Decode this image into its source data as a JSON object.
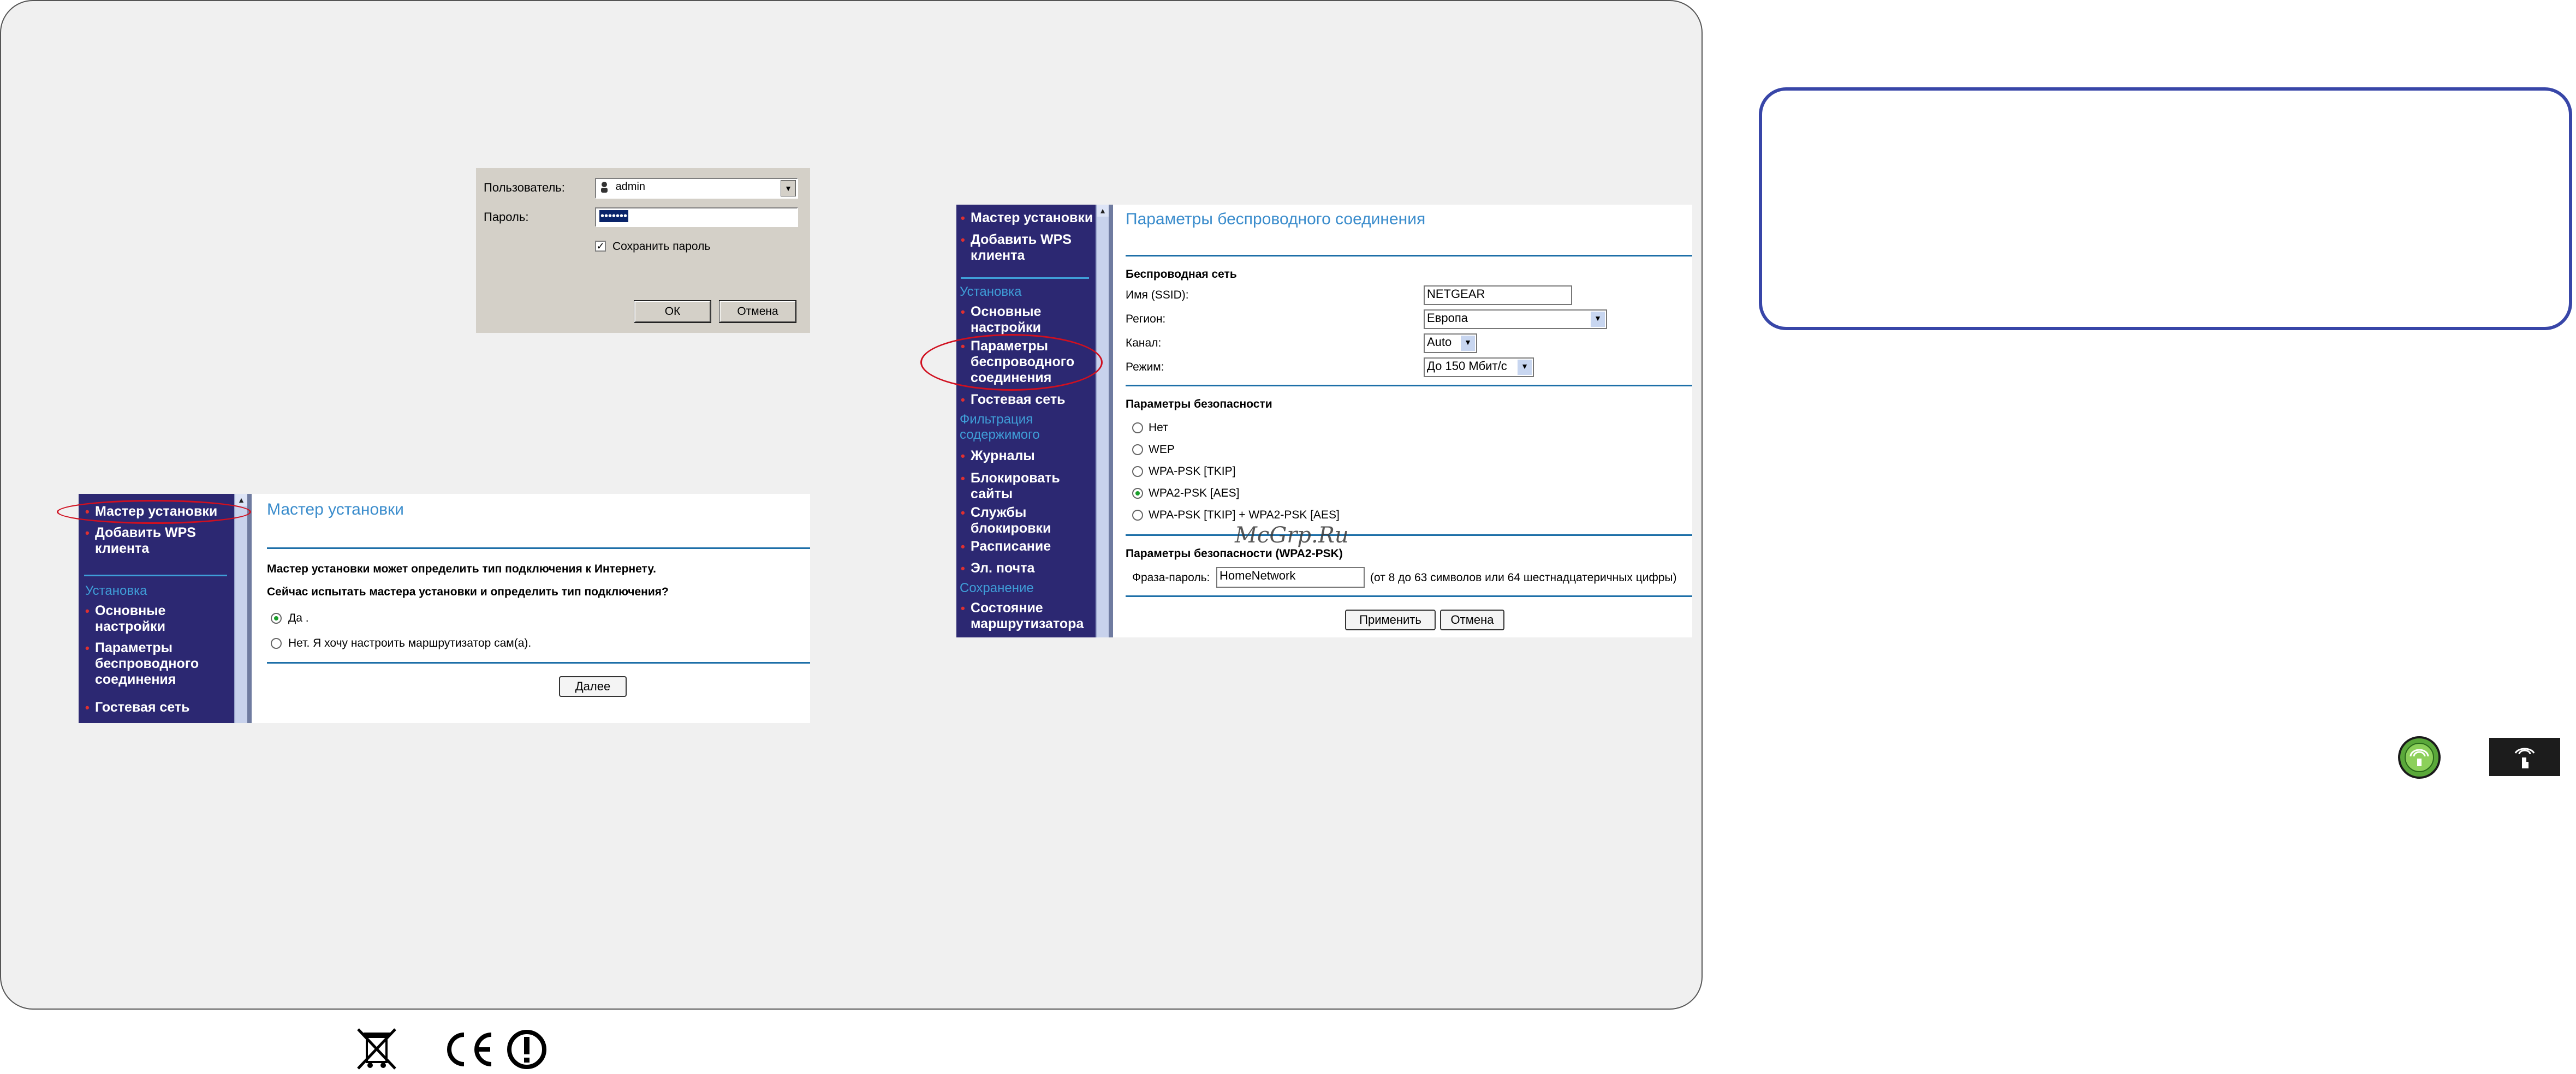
{
  "login_dialog": {
    "user_label": "Пользователь:",
    "user_value": "admin",
    "password_label": "Пароль:",
    "password_value": "•••••••",
    "remember_label": "Сохранить пароль",
    "ok_label": "ОК",
    "cancel_label": "Отмена"
  },
  "wizard_screen": {
    "sidebar": {
      "items": [
        "Мастер установки",
        "Добавить WPS клиента"
      ],
      "section": "Установка",
      "setup_items": [
        "Основные настройки",
        "Параметры беспроводного соединения",
        "Гостевая сеть"
      ]
    },
    "title": "Мастер установки",
    "text1": "Мастер установки может определить тип подключения к Интернету.",
    "text2": "Сейчас испытать мастера установки и определить тип подключения?",
    "option_yes": "Да .",
    "option_no": "Нет. Я хочу настроить маршрутизатор сам(а).",
    "next_label": "Далее"
  },
  "wireless_screen": {
    "sidebar": {
      "items": [
        "Мастер установки",
        "Добавить WPS клиента"
      ],
      "section1": "Установка",
      "setup_items": [
        "Основные настройки",
        "Параметры беспроводного соединения",
        "Гостевая сеть"
      ],
      "section2": "Фильтрация содержимого",
      "filter_items": [
        "Журналы",
        "Блокировать сайты",
        "Службы блокировки",
        "Расписание",
        "Эл. почта"
      ],
      "section3": "Сохранение",
      "maint_items": [
        "Состояние маршрутизатора"
      ]
    },
    "title": "Параметры беспроводного соединения",
    "wireless_network_heading": "Беспроводная сеть",
    "ssid_label": "Имя (SSID):",
    "ssid_value": "NETGEAR",
    "region_label": "Регион:",
    "region_value": "Европа",
    "channel_label": "Канал:",
    "channel_value": "Auto",
    "mode_label": "Режим:",
    "mode_value": "До 150 Мбит/с",
    "security_heading": "Параметры безопасности",
    "security_options": [
      "Нет",
      "WEP",
      "WPA-PSK [TKIP]",
      "WPA2-PSK [AES]",
      "WPA-PSK [TKIP] + WPA2-PSK [AES]"
    ],
    "selected_security": "WPA2-PSK [AES]",
    "wpa2_heading": "Параметры безопасности (WPA2-PSK)",
    "passphrase_label": "Фраза-пароль:",
    "passphrase_value": "HomeNetwork",
    "passphrase_hint": "(от 8 до 63 символов или 64 шестнадцатеричных цифры)",
    "apply_label": "Применить",
    "cancel_label": "Отмена"
  },
  "watermark": "McGrp.Ru",
  "colors": {
    "sidebar": "#2c2872",
    "accent_blue": "#3a8ccc",
    "highlight_red": "#d01020",
    "box_border": "#3846a8"
  },
  "icons": [
    "wps-button-icon",
    "wps-push-icon",
    "weee-bin-icon",
    "ce-mark-icon",
    "alert-circle-icon"
  ]
}
